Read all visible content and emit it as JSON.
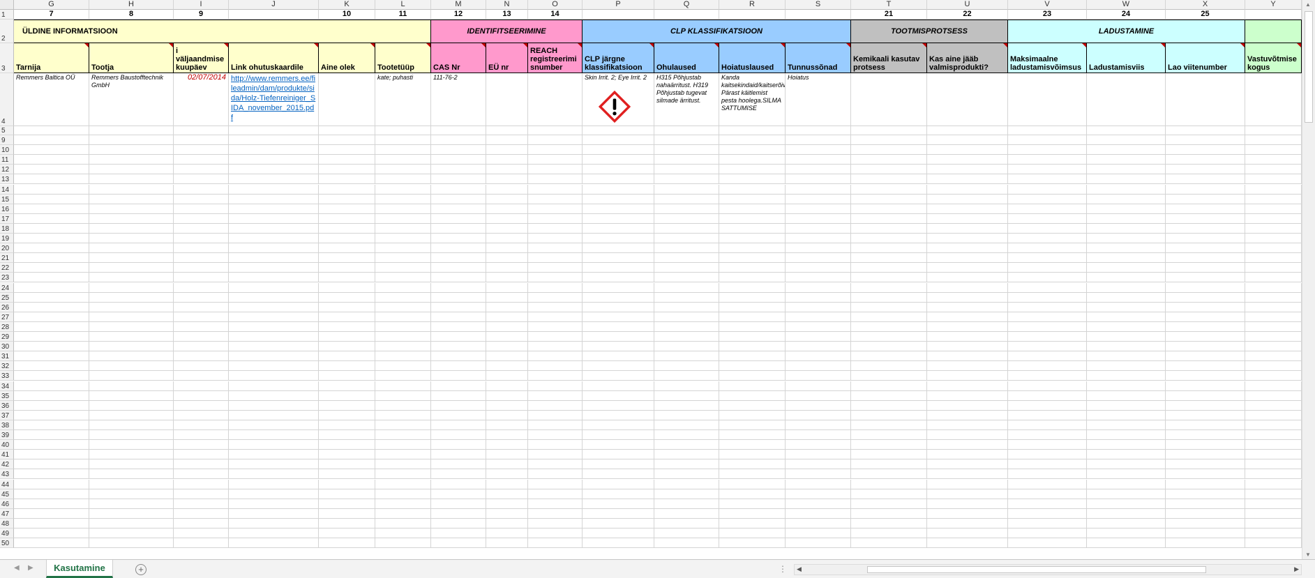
{
  "columns": [
    "G",
    "H",
    "I",
    "J",
    "K",
    "L",
    "M",
    "N",
    "O",
    "P",
    "Q",
    "R",
    "S",
    "T",
    "U",
    "V",
    "W",
    "X",
    "Y"
  ],
  "row1_numbers": {
    "G": "7",
    "H": "8",
    "I": "9",
    "J": "",
    "K": "10",
    "L": "11",
    "M": "12",
    "N": "13",
    "O": "14",
    "P": "",
    "Q": "",
    "R": "",
    "S": "",
    "T": "21",
    "U": "22",
    "V": "23",
    "W": "24",
    "X": "25",
    "Y": ""
  },
  "sections": {
    "general": "ÜLDINE INFORMATSIOON",
    "identification": "IDENTIFITSEERIMINE",
    "clp": "CLP KLASSIFIKATSIOON",
    "production": "TOOTMISPROTSESS",
    "storage": "LADUSTAMINE",
    "accept": ""
  },
  "headers": {
    "G": "Tarnija",
    "H": "Tootja",
    "I": "i väljaandmise kuupäev",
    "J": "Link ohutuskaardile",
    "K": "Aine olek",
    "L": "Tootetüüp",
    "M": "CAS Nr",
    "N": "EÜ nr",
    "O": "REACH registreerimi snumber",
    "P": "CLP järgne klassifikatsioon",
    "Q": "Ohulaused",
    "R": "Hoiatuslaused",
    "S": "Tunnussõnad",
    "T": "Kemikaali kasutav protsess",
    "U": "Kas aine jääb valmisprodukti?",
    "V": "Maksimaalne ladustamisvõimsus",
    "W": "Ladustamisviis",
    "X": "Lao viitenumber",
    "Y": "Vastuvõtmise kogus"
  },
  "row4": {
    "G": "Remmers Baltica OÜ",
    "H": "Remmers Baustofftechnik GmbH",
    "I": "02/07/2014",
    "J": "http://www.remmers.ee/fileadmin/dam/produkte/sida/Holz-Tiefenreiniger_SIDA_november_2015.pdf",
    "L": "kate; puhasti",
    "M": "111-76-2",
    "P": "Skin Irrit. 2; Eye Irrit. 2",
    "Q": "H315 Põhjustab nahaärritust.  H319 Põhjustab tugevat silmade ärritust.",
    "R": "Kanda kaitsekindaid/kaitserõivastust/kaitseprille/kaitsemaski. Pärast käitlemist pesta hoolega.SILMA SATTUMISE",
    "S": "Hoiatus"
  },
  "row_numbers": [
    "1",
    "2",
    "3",
    "4",
    "5",
    "9",
    "10",
    "11",
    "12",
    "13",
    "14",
    "15",
    "16",
    "17",
    "18",
    "19",
    "20",
    "21",
    "22",
    "23",
    "24",
    "25",
    "26",
    "27",
    "28",
    "29",
    "30",
    "31",
    "32",
    "33",
    "34",
    "35",
    "36",
    "37",
    "38",
    "39",
    "40",
    "41",
    "42",
    "43",
    "44",
    "45",
    "46",
    "47",
    "48",
    "49",
    "50"
  ],
  "sheet_tab": "Kasutamine",
  "icons": {
    "hazard": "exclamation-hazard-icon",
    "add": "plus-icon"
  },
  "colors": {
    "yellow": "#ffffcc",
    "pink": "#ff99cc",
    "blue": "#99ccff",
    "gray": "#c0c0c0",
    "cyan": "#ccffff",
    "green": "#ccffcc",
    "tab": "#217346"
  }
}
